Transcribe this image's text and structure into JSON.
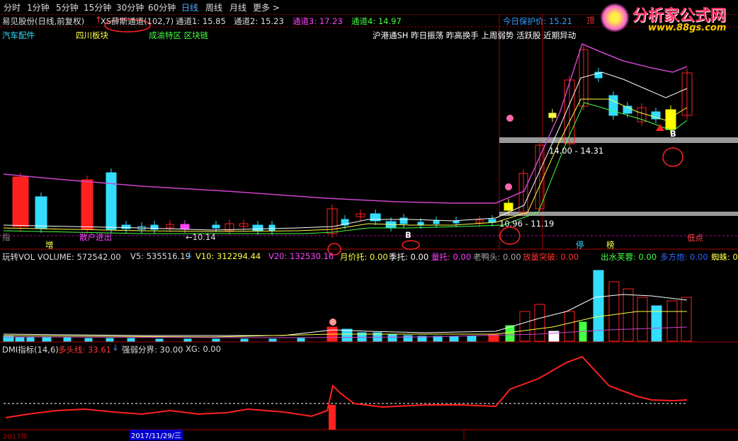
{
  "toolbar": {
    "periods": [
      "分时",
      "1分钟",
      "5分钟",
      "15分钟",
      "30分钟",
      "60分钟",
      "日线",
      "周线",
      "月线",
      "更多"
    ],
    "active": "日线"
  },
  "header": {
    "stock": "易见股份(日线,前复权)",
    "indicator": "XS薛斯通道(102,7)",
    "ch1": "通道1: 15.85",
    "ch2": "通道2: 15.23",
    "ch3": "通道3: 17.23",
    "ch4": "通道4: 14.97",
    "protect": "今日保护价: 15.21",
    "ding": "顶"
  },
  "tags": {
    "sector1": "汽车配件",
    "sector2": "四川板块",
    "sector3": "成渝特区 区块链",
    "concepts": "沪港通SH 昨日振荡 昨高换手 上周弱势 活跃股 近期异动"
  },
  "annotations": {
    "range_high": "14.00 - 14.31",
    "range_low": "10.96 - 11.19",
    "low_price": "←10.14",
    "low_point": "低点",
    "zeng": "增",
    "sanhu": "散户进出",
    "ting": "停",
    "bang": "榜",
    "B1": "B",
    "B2": "B",
    "zhi": "指"
  },
  "vol": {
    "title": "玩转VOL VOLUME: 572542.00",
    "v5": "V5: 535516.19",
    "v10": "V10: 312294.44",
    "v20": "V20: 132530.16",
    "yue": "月价托: 0.00",
    "ji": "季托: 0.00",
    "liang": "量托: 0.00",
    "lao": "老鸭头: 0.00",
    "fang": "放量突破: 0.00",
    "chu": "出水芙蓉: 0.00",
    "duo": "多方炮: 0.00",
    "zhu": "蜘蛛: 0.00"
  },
  "dmi": {
    "title": "DMI指标(14,6)",
    "duo": "多头线: 33.61",
    "ruo": "强弱分界: 30.00",
    "xg": "XG: 0.00"
  },
  "footer": {
    "year": "2017年",
    "date": "2017/11/29/三"
  },
  "logo": {
    "text": "分析家公式网",
    "url": "www.88gs.com"
  },
  "colors": {
    "up": "#ff2020",
    "down": "#33ddff",
    "grid": "#aa0000",
    "accent": "#ff3333"
  }
}
